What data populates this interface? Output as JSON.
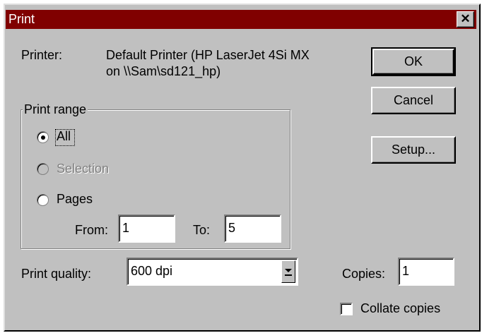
{
  "window": {
    "title": "Print",
    "close_glyph": "✕"
  },
  "printer": {
    "label": "Printer:",
    "name_line1": "Default Printer (HP LaserJet 4Si MX",
    "name_line2": "on \\\\Sam\\sd121_hp)"
  },
  "buttons": {
    "ok": "OK",
    "cancel": "Cancel",
    "setup": "Setup..."
  },
  "print_range": {
    "legend": "Print range",
    "all_label": "All",
    "selection_label": "Selection",
    "pages_label": "Pages",
    "selected": "All",
    "selection_enabled": false,
    "from_label": "From:",
    "from_value": "1",
    "to_label": "To:",
    "to_value": "5"
  },
  "quality": {
    "label": "Print quality:",
    "value": "600 dpi"
  },
  "copies": {
    "label": "Copies:",
    "value": "1"
  },
  "collate": {
    "label": "Collate copies",
    "checked": false
  },
  "icons": {
    "close": "close-icon",
    "dropdown": "chevron-down-icon"
  }
}
